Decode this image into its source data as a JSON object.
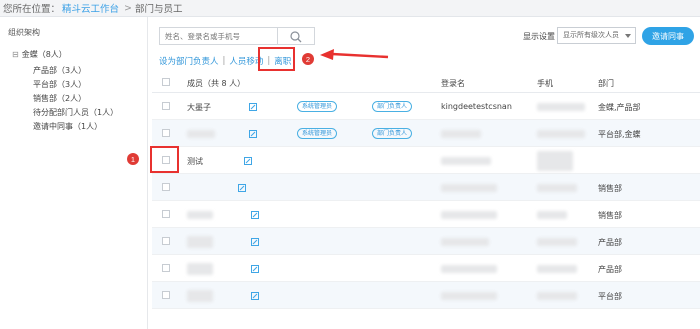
{
  "breadcrumb": {
    "prefix": "您所在位置：",
    "home": "精斗云工作台",
    "separator": ">",
    "current": "部门与员工"
  },
  "sidebar": {
    "title": "组织架构",
    "root": {
      "toggle": "⊟",
      "label": "金蝶（8人）"
    },
    "items": [
      {
        "label": "产品部（3人）"
      },
      {
        "label": "平台部（3人）"
      },
      {
        "label": "销售部（2人）"
      },
      {
        "label": "待分配部门人员（1人）"
      },
      {
        "label": "邀请中同事（1人）"
      }
    ]
  },
  "search": {
    "placeholder": "姓名、登录名或手机号",
    "icon": "search-icon"
  },
  "display": {
    "label": "显示设置",
    "select_value": "显示所有级次人员"
  },
  "invite_button": "邀请同事",
  "actions": {
    "set_leader": "设为部门负责人",
    "move_member": "人员移动",
    "leave": "离职"
  },
  "badges": {
    "one": "1",
    "two": "2"
  },
  "table": {
    "headers": {
      "member": "成员（共 8 人）",
      "login": "登录名",
      "phone": "手机",
      "department": "部门"
    },
    "rows": [
      {
        "name": "大墨子",
        "tags": [
          "系统管理员",
          "部门负责人"
        ],
        "login": "kingdeetestcsnan",
        "phone": "",
        "department": "金蝶,产品部"
      },
      {
        "name": "",
        "tags": [
          "系统管理员",
          "部门负责人"
        ],
        "login": "",
        "phone": "",
        "department": "平台部,金蝶"
      },
      {
        "name": "测试",
        "tags": [],
        "login": "",
        "phone": "",
        "department": ""
      },
      {
        "name": "",
        "tags": [],
        "login": "",
        "phone": "",
        "department": "销售部"
      },
      {
        "name": "",
        "tags": [],
        "login": "",
        "phone": "",
        "department": "销售部"
      },
      {
        "name": "",
        "tags": [],
        "login": "",
        "phone": "",
        "department": "产品部"
      },
      {
        "name": "",
        "tags": [],
        "login": "",
        "phone": "",
        "department": "产品部"
      },
      {
        "name": "",
        "tags": [],
        "login": "",
        "phone": "",
        "department": "平台部"
      }
    ]
  },
  "colors": {
    "accent": "#2fa3e6",
    "link": "#2f95d9",
    "highlight": "#e8312f",
    "row_alt": "#f4f8fc"
  }
}
